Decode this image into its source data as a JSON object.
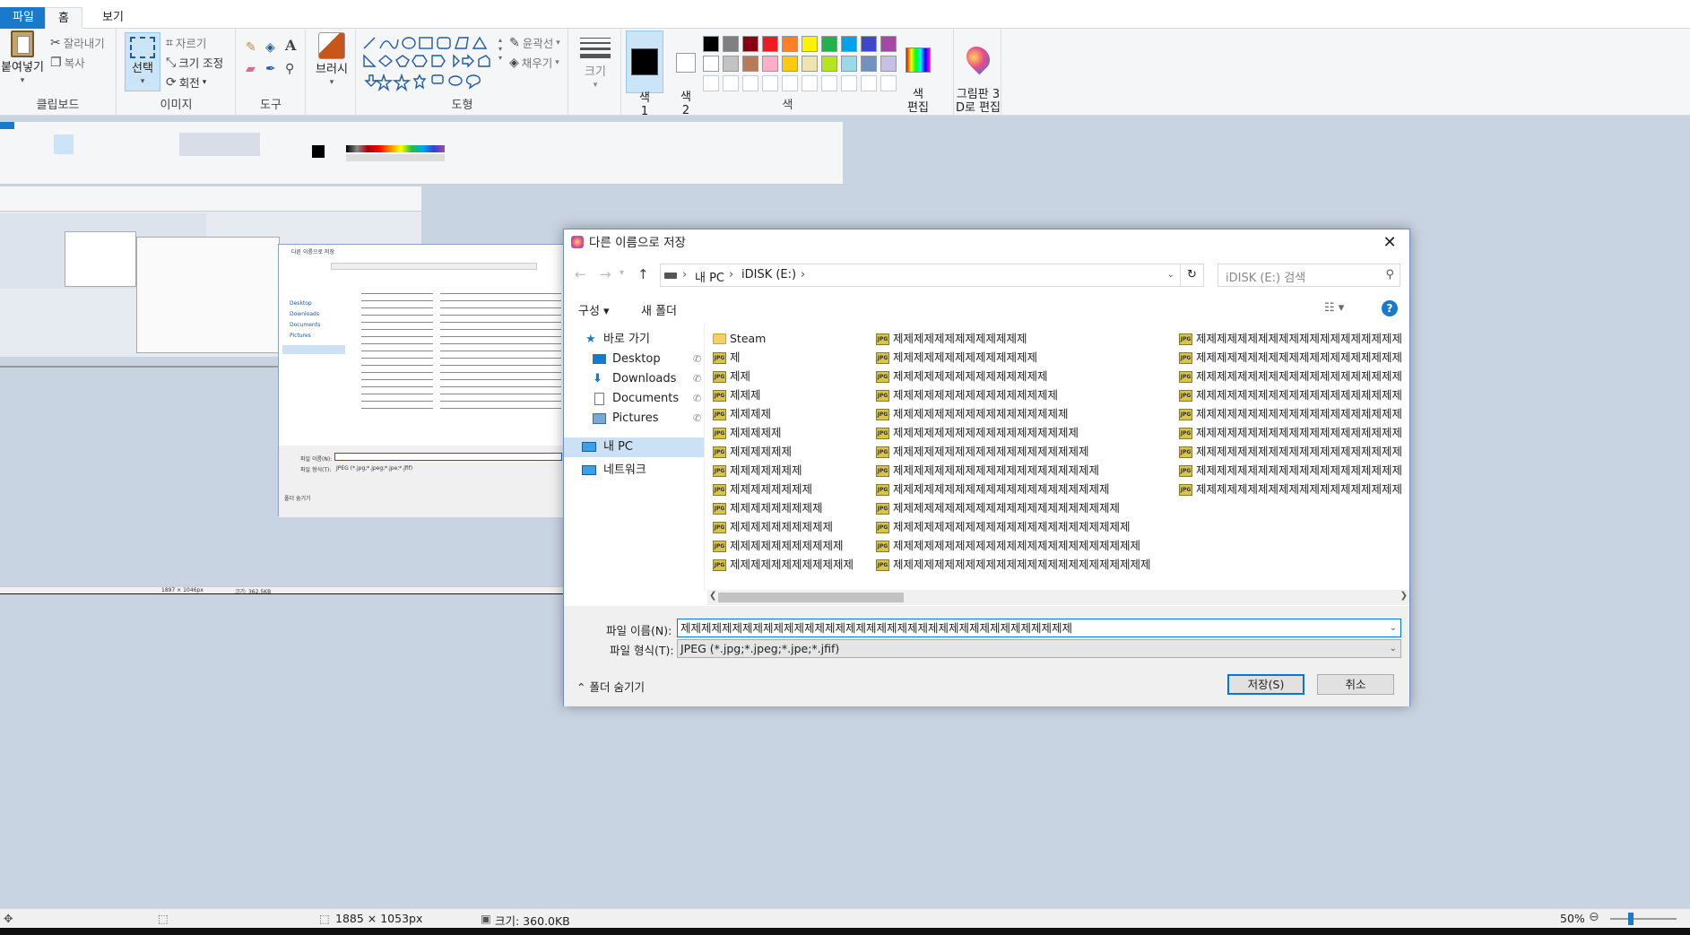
{
  "ribbon": {
    "tabs": [
      "파일",
      "홈",
      "보기"
    ],
    "clipboard": {
      "paste": "붙여넣기",
      "cut": "잘라내기",
      "copy": "복사",
      "label": "클립보드"
    },
    "image": {
      "select": "선택",
      "crop": "자르기",
      "resize": "크기 조정",
      "rotate": "회전",
      "label": "이미지"
    },
    "tools": {
      "label": "도구"
    },
    "brush": {
      "label": "브러시"
    },
    "shapes": {
      "outline": "윤곽선",
      "fill": "채우기",
      "label": "도형"
    },
    "size": {
      "label": "크기"
    },
    "colors": {
      "color1": "색\n1",
      "color2": "색\n2",
      "edit": "색\n편집",
      "label": "색",
      "palette_row1": [
        "#000000",
        "#7f7f7f",
        "#880015",
        "#ed1c24",
        "#ff7f27",
        "#fff200",
        "#22b14c",
        "#00a2e8",
        "#3f48cc",
        "#a349a4"
      ],
      "palette_row2": [
        "#ffffff",
        "#c3c3c3",
        "#b97a57",
        "#ffaec9",
        "#ffc90e",
        "#efe4b0",
        "#b5e61d",
        "#99d9ea",
        "#7092be",
        "#c8bfe7"
      ]
    },
    "paint3d": "그림판 3\nD로 편집"
  },
  "status": {
    "dimensions": "1885 × 1053px",
    "size": "크기: 360.0KB",
    "zoom": "50%"
  },
  "dialog": {
    "title": "다른 이름으로 저장",
    "breadcrumb": [
      "내 PC",
      "iDISK (E:)"
    ],
    "search_placeholder": "iDISK (E:) 검색",
    "organize": "구성",
    "new_folder": "새 폴더",
    "nav": {
      "quick_access": "바로 가기",
      "items": [
        "Desktop",
        "Downloads",
        "Documents",
        "Pictures"
      ],
      "this_pc": "내 PC",
      "network": "네트워크"
    },
    "files_col1": [
      "Steam",
      "제",
      "제제",
      "제제제",
      "제제제제",
      "제제제제제",
      "제제제제제제",
      "제제제제제제제",
      "제제제제제제제제",
      "제제제제제제제제제",
      "제제제제제제제제제제",
      "제제제제제제제제제제제",
      "제제제제제제제제제제제제"
    ],
    "files_col2": [
      "제제제제제제제제제제제제제",
      "제제제제제제제제제제제제제제",
      "제제제제제제제제제제제제제제제",
      "제제제제제제제제제제제제제제제제",
      "제제제제제제제제제제제제제제제제제",
      "제제제제제제제제제제제제제제제제제제",
      "제제제제제제제제제제제제제제제제제제제",
      "제제제제제제제제제제제제제제제제제제제제",
      "제제제제제제제제제제제제제제제제제제제제제",
      "제제제제제제제제제제제제제제제제제제제제제제",
      "제제제제제제제제제제제제제제제제제제제제제제제",
      "제제제제제제제제제제제제제제제제제제제제제제제제",
      "제제제제제제제제제제제제제제제제제제제제제제제제제"
    ],
    "files_col3": [
      "제제제제제제제제제제제제제제제제제제제제",
      "제제제제제제제제제제제제제제제제제제제제",
      "제제제제제제제제제제제제제제제제제제제제",
      "제제제제제제제제제제제제제제제제제제제제",
      "제제제제제제제제제제제제제제제제제제제제",
      "제제제제제제제제제제제제제제제제제제제제",
      "제제제제제제제제제제제제제제제제제제제제",
      "제제제제제제제제제제제제제제제제제제제제",
      "제제제제제제제제제제제제제제제제제제제제"
    ],
    "filename_label": "파일 이름(N):",
    "filename_value": "제제제제제제제제제제제제제제제제제제제제제제제제제제제제제제제제제제제제제제",
    "filetype_label": "파일 형식(T):",
    "filetype_value": "JPEG (*.jpg;*.jpeg;*.jpe;*.jfif)",
    "hide_folders": "폴더 숨기기",
    "save": "저장(S)",
    "cancel": "취소"
  },
  "nested": {
    "dialog_title": "다른 이름으로 저장",
    "filename_label": "파일 이름(N):",
    "filetype_label": "파일 형식(T):",
    "filetype_value": "JPEG (*.jpg;*.jpeg;*.jpe;*.jfif)",
    "hide_folders": "폴더 숨기기",
    "status_dims": "1897 × 1046px",
    "status_size": "크기: 362.5KB"
  }
}
